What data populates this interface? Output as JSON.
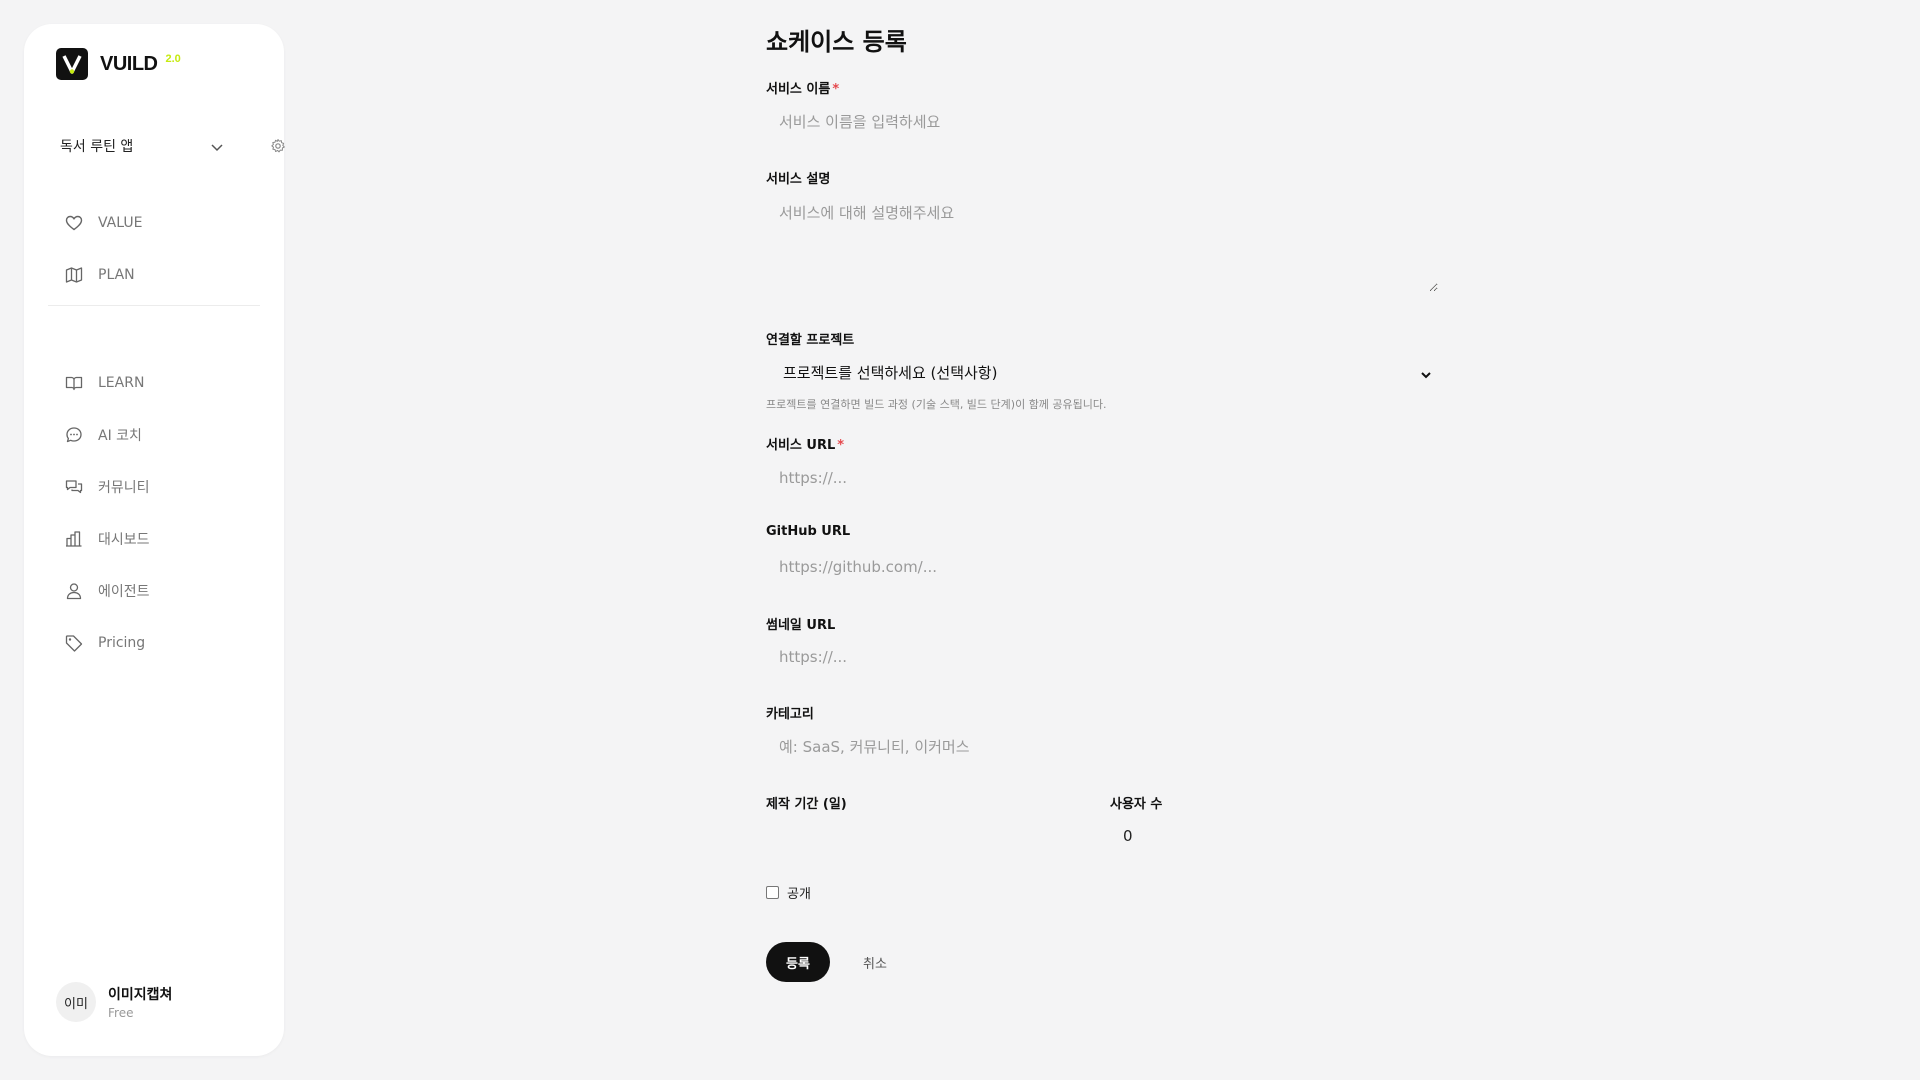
{
  "sidebar": {
    "logo": {
      "text": "VUILD",
      "version": "2.0"
    },
    "project": {
      "name": "독서 루틴 앱"
    },
    "nav_top": [
      {
        "label": "VALUE",
        "icon": "heart-icon"
      },
      {
        "label": "PLAN",
        "icon": "map-icon"
      }
    ],
    "nav_bottom": [
      {
        "label": "LEARN",
        "icon": "book-icon"
      },
      {
        "label": "AI 코치",
        "icon": "chat-bubble-icon"
      },
      {
        "label": "커뮤니티",
        "icon": "chat-bubbles-icon"
      },
      {
        "label": "대시보드",
        "icon": "bar-chart-icon"
      },
      {
        "label": "에이전트",
        "icon": "person-icon"
      },
      {
        "label": "Pricing",
        "icon": "tag-icon"
      }
    ],
    "user": {
      "avatar": "이미",
      "name": "이미지캡쳐",
      "plan": "Free"
    }
  },
  "form": {
    "title": "쇼케이스 등록",
    "service_name": {
      "label": "서비스 이름",
      "required": "*",
      "placeholder": "서비스 이름을 입력하세요"
    },
    "service_desc": {
      "label": "서비스 설명",
      "placeholder": "서비스에 대해 설명해주세요"
    },
    "project": {
      "label": "연결할 프로젝트",
      "selected": "프로젝트를 선택하세요 (선택사항)",
      "help": "프로젝트를 연결하면 빌드 과정 (기술 스택, 빌드 단계)이 함께 공유됩니다."
    },
    "service_url": {
      "label": "서비스 URL",
      "required": "*",
      "placeholder": "https://..."
    },
    "github_url": {
      "label": "GitHub URL",
      "placeholder": "https://github.com/..."
    },
    "thumbnail_url": {
      "label": "썸네일 URL",
      "placeholder": "https://..."
    },
    "category": {
      "label": "카테고리",
      "placeholder": "예: SaaS, 커뮤니티, 이커머스"
    },
    "duration": {
      "label": "제작 기간 (일)",
      "value": ""
    },
    "user_count": {
      "label": "사용자 수",
      "value": "0"
    },
    "public": {
      "label": "공개",
      "checked": false
    },
    "submit_label": "등록",
    "cancel_label": "취소"
  },
  "colors": {
    "background": "#f4f4f5",
    "accent": "#c6ea11",
    "primary_button": "#111111",
    "required": "#e5484d"
  }
}
